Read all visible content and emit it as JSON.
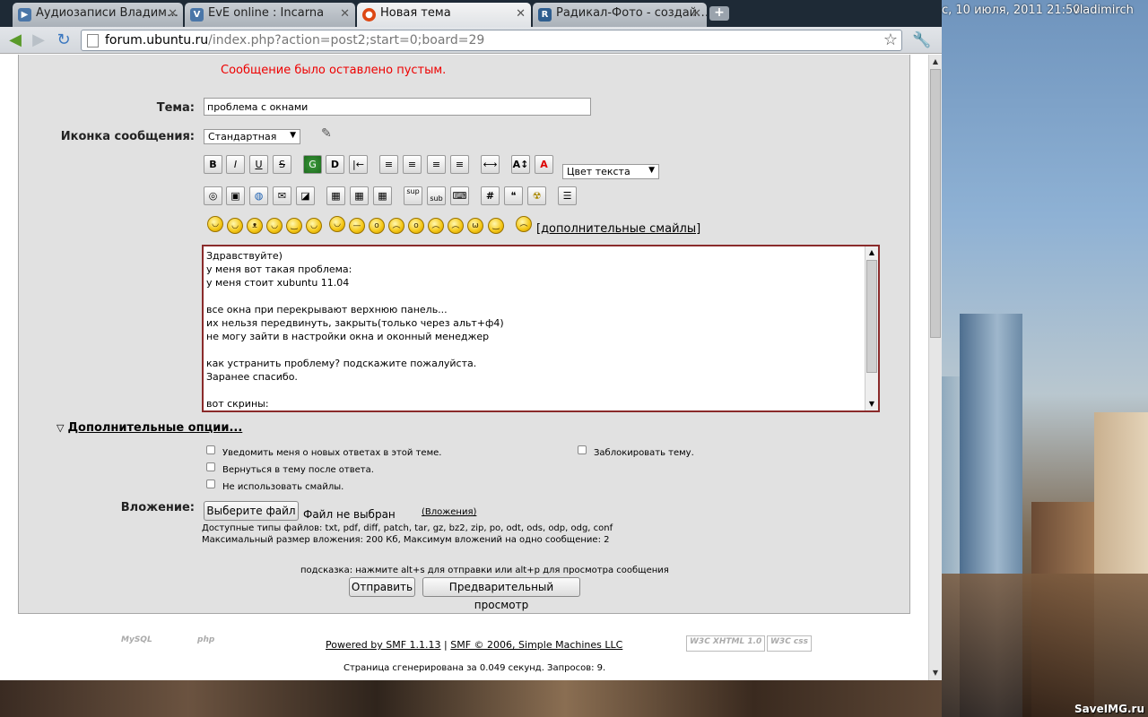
{
  "desktop": {
    "clock": "с, 10 июля, 2011 21:50",
    "user": "vladimirch",
    "watermark": "SaveIMG.ru"
  },
  "tabs": [
    {
      "title": "Аудиозаписи Владим…",
      "icon": "vk-icon",
      "color": "#4a76a8",
      "letter": "▶"
    },
    {
      "title": "EvE online : Incarna",
      "icon": "vk-icon",
      "color": "#4a76a8",
      "letter": "V"
    },
    {
      "title": "Новая тема",
      "icon": "ubuntu-icon",
      "color": "#dd4814",
      "letter": "●",
      "active": true
    },
    {
      "title": "Радикал-Фото - создай…",
      "icon": "radikal-icon",
      "color": "#2f5e8f",
      "letter": "R"
    }
  ],
  "newtab_label": "+",
  "address": {
    "domain": "forum.ubuntu.ru",
    "path": "/index.php?action=post2;start=0;board=29"
  },
  "form": {
    "error": "Сообщение было оставлено пустым.",
    "subject_label": "Тема:",
    "subject_value": "проблема с окнами",
    "icon_label": "Иконка сообщения:",
    "icon_select": "Стандартная",
    "color_select": "Цвет текста",
    "more_smileys": "[дополнительные смайлы]",
    "message": "Здравствуйте)\nу меня вот такая проблема:\nу меня стоит xubuntu 11.04\n\nвсе окна при перекрывают верхнюю панель...\nих нельзя передвинуть, закрыть(только через альт+ф4)\nне могу зайти в настройки окна и оконный менеджер\n\nкак устранить проблему? подскажите пожалуйста.\nЗаранее спасибо.\n\nвот скрины:",
    "more_options": "Дополнительные опции...",
    "opt_notify": "Уведомить меня о новых ответах в этой теме.",
    "opt_lock": "Заблокировать тему.",
    "opt_return": "Вернуться в тему после ответа.",
    "opt_nosmileys": "Не использовать смайлы.",
    "attach_label": "Вложение:",
    "choose_file": "Выберите файл",
    "no_file": "Файл не выбран",
    "attachments_link": "(Вложения)",
    "allowed_types": "Доступные типы файлов: txt, pdf, diff, patch, tar, gz, bz2, zip, po, odt, ods, odp, odg, conf",
    "max_size": "Максимальный размер вложения: 200 Кб, Максимум вложений на одно сообщение: 2",
    "hint": "подсказка: нажмите alt+s для отправки или alt+p для просмотра сообщения",
    "submit": "Отправить",
    "preview": "Предварительный просмотр"
  },
  "footer": {
    "powered": "Powered by SMF 1.1.13",
    "sep": " | ",
    "copyright": "SMF © 2006, Simple Machines LLC",
    "stats": "Страница сгенерирована за 0.049 секунд. Запросов: 9.",
    "badge_mysql": "MySQL",
    "badge_php": "php",
    "badge_xhtml": "W3C XHTML 1.0",
    "badge_css": "W3C css"
  }
}
